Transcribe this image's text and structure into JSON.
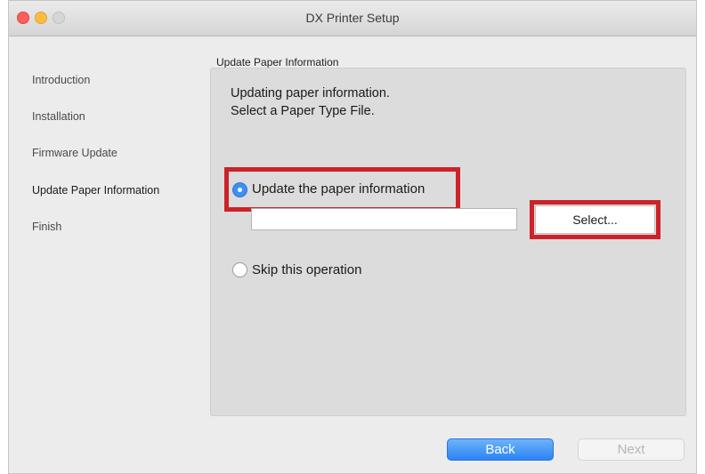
{
  "window": {
    "title": "DX Printer Setup"
  },
  "sidebar": {
    "items": [
      {
        "label": "Introduction"
      },
      {
        "label": "Installation"
      },
      {
        "label": "Firmware Update"
      },
      {
        "label": "Update Paper Information",
        "active": true
      },
      {
        "label": "Finish"
      }
    ]
  },
  "main": {
    "section_title": "Update Paper Information",
    "description_line1": "Updating paper information.",
    "description_line2": "Select a Paper Type File.",
    "options": [
      {
        "label": "Update the paper information",
        "selected": true
      },
      {
        "label": "Skip this operation",
        "selected": false
      }
    ],
    "file_path": {
      "value": "",
      "placeholder": ""
    },
    "select_button_label": "Select..."
  },
  "footer": {
    "back_label": "Back",
    "next_label": "Next"
  },
  "colors": {
    "accent": "#3d8ff5",
    "highlight": "#cc2229",
    "panel": "#dcdcdc",
    "window": "#ececec"
  },
  "icons": {
    "close": "close-icon",
    "minimize": "minimize-icon",
    "zoom": "zoom-icon"
  }
}
